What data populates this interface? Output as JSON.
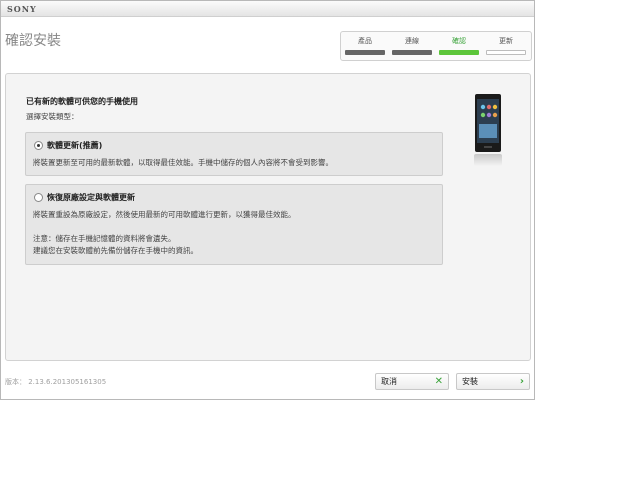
{
  "brand": "SONY",
  "title": "確認安裝",
  "steps": [
    {
      "label": "產品"
    },
    {
      "label": "連線"
    },
    {
      "label": "確認"
    },
    {
      "label": "更新"
    }
  ],
  "content": {
    "heading": "已有新的軟體可供您的手機使用",
    "subheading": "選擇安裝類型：",
    "options": [
      {
        "title": "軟體更新(推薦)",
        "desc": "將裝置更新至可用的最新軟體，以取得最佳效能。手機中儲存的個人內容將不會受到影響。",
        "selected": true
      },
      {
        "title": "恢復原廠設定與軟體更新",
        "desc": "將裝置重設為原廠設定，然後使用最新的可用軟體進行更新，以獲得最佳效能。",
        "note1": "注意：儲存在手機記憶體的資料將會遺失。",
        "note2": "建議您在安裝軟體前先備份儲存在手機中的資訊。",
        "selected": false
      }
    ]
  },
  "version": "版本： 2.13.6.201305161305",
  "buttons": {
    "cancel": "取消",
    "install": "安裝"
  },
  "colors": {
    "accent_green": "#5cc53a",
    "step_done": "#666666"
  }
}
